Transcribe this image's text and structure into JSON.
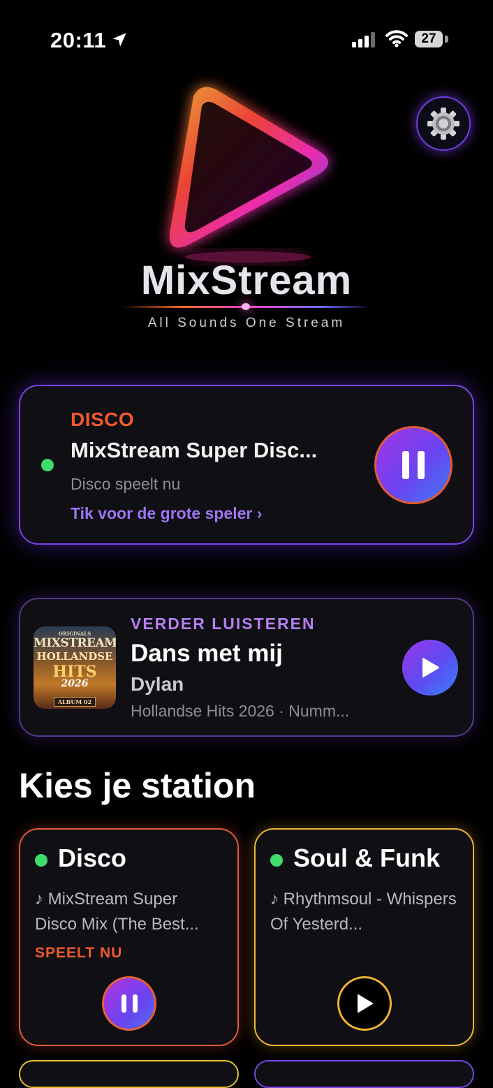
{
  "status_bar": {
    "time": "20:11",
    "battery": "27"
  },
  "logo": {
    "title": "MixStream",
    "tagline": "All Sounds One Stream"
  },
  "now_playing": {
    "genre": "DISCO",
    "title": "MixStream Super Disc...",
    "status": "Disco speelt nu",
    "link": "Tik voor de grote speler ›"
  },
  "continue_listening": {
    "label": "VERDER LUISTEREN",
    "title": "Dans met mij",
    "artist": "Dylan",
    "meta": "Hollandse Hits 2026 · Numm...",
    "album_art": {
      "line1": "MIXSTREAM",
      "line2": "HOLLANDSE",
      "line3": "HITS",
      "line4": "2026",
      "line5": "ALBUM 02"
    }
  },
  "section": {
    "title": "Kies je station"
  },
  "stations": [
    {
      "name": "Disco",
      "track": "♪ MixStream Super Disco Mix (The Best...",
      "status": "SPEELT NU",
      "accent": "#e25a3a"
    },
    {
      "name": "Soul & Funk",
      "track": "♪ Rhythmsoul - Whispers Of Yesterd...",
      "accent": "#f0b432"
    }
  ],
  "colors": {
    "accent_purple": "#7a45e8",
    "accent_orange": "#f05a2d",
    "live_green": "#3fdc6c"
  },
  "icons": [
    "location-arrow-icon",
    "signal-icon",
    "wifi-icon",
    "battery-icon",
    "gear-icon",
    "pause-icon",
    "play-icon"
  ]
}
